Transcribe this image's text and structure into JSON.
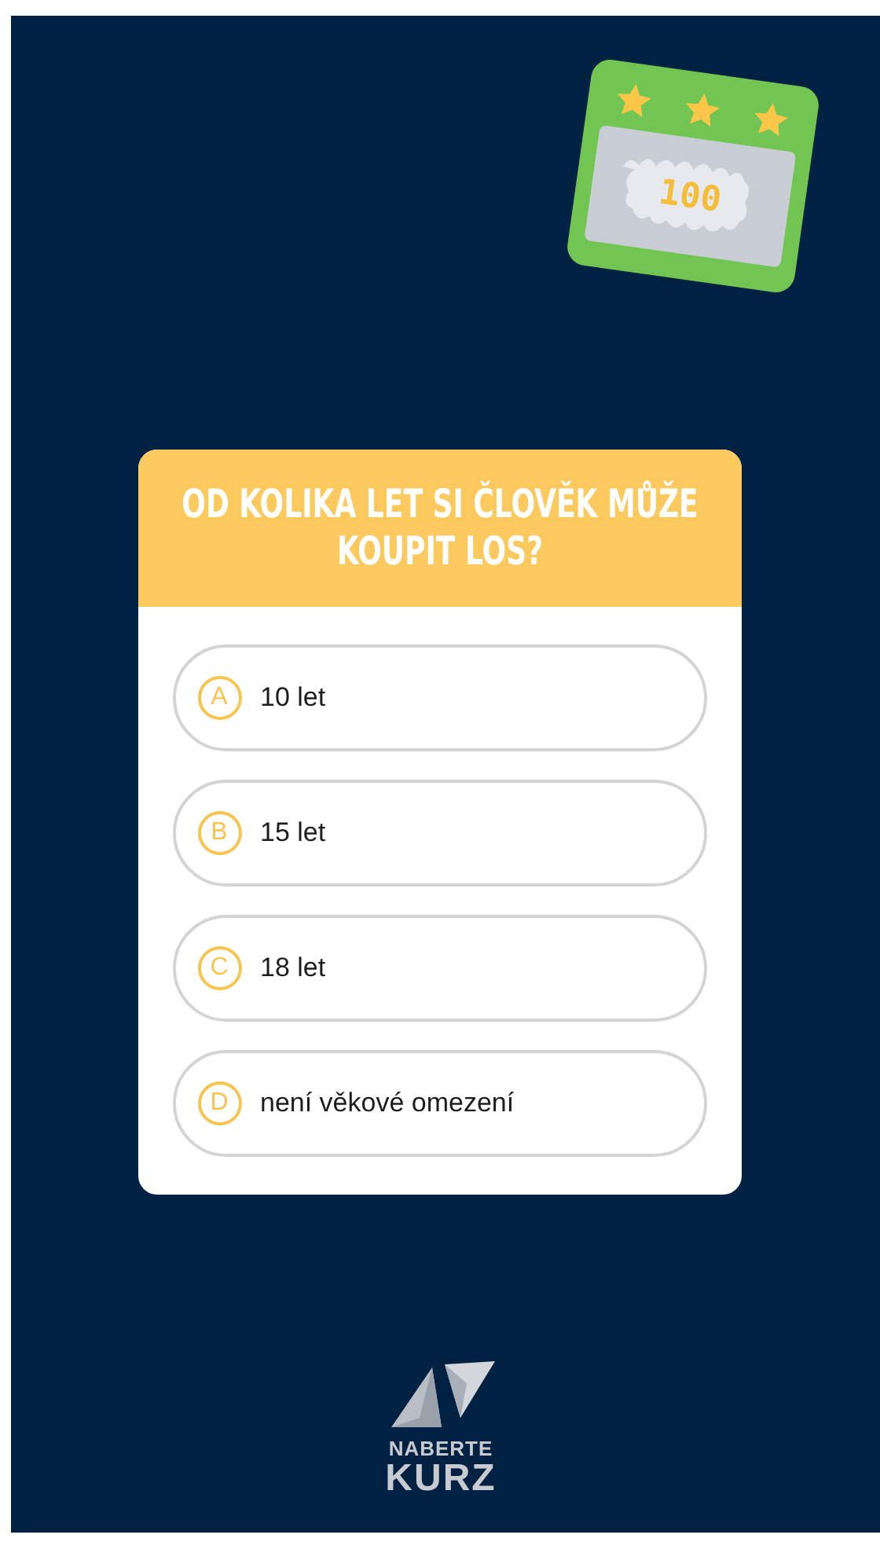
{
  "ticket": {
    "value": "100"
  },
  "question": {
    "title": "OD KOLIKA LET SI ČLOVĚK MŮŽE KOUPIT LOS?",
    "answers": [
      {
        "letter": "A",
        "text": "10 let"
      },
      {
        "letter": "B",
        "text": "15 let"
      },
      {
        "letter": "C",
        "text": "18 let"
      },
      {
        "letter": "D",
        "text": "není věkové omezení"
      }
    ]
  },
  "logo": {
    "line_1": "NABERTE",
    "line_2": "KURZ"
  }
}
